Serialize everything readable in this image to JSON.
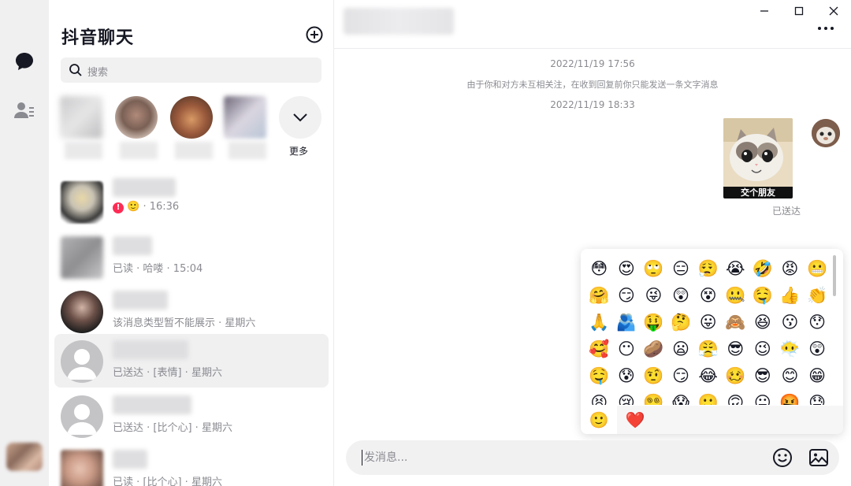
{
  "list": {
    "title": "抖音聊天",
    "search_placeholder": "搜索",
    "more_label": "更多",
    "conversations": [
      {
        "subtitle": "🙂 · 16:36",
        "alert": "!"
      },
      {
        "subtitle": "已读 · 哈喽 · 15:04"
      },
      {
        "subtitle": "该消息类型暂不能展示 · 星期六"
      },
      {
        "subtitle": "已送达 · [表情] · 星期六"
      },
      {
        "subtitle": "已送达 · [比个心] · 星期六"
      },
      {
        "subtitle": "已读 · [比个心] · 星期六"
      }
    ]
  },
  "chat": {
    "timestamp_1": "2022/11/19 17:56",
    "system_notice": "由于你和对方未互相关注，在收到回复前你只能发送一条文字消息",
    "timestamp_2": "2022/11/19 18:33",
    "sticker_caption": "交个朋友",
    "sent_status": "已送达",
    "input_placeholder": "发消息..."
  },
  "emoji_panel": {
    "emojis": [
      "😳",
      "😍",
      "🙄",
      "😑",
      "😮‍💨",
      "😭",
      "🤣",
      "😡",
      "😬",
      "🤗",
      "😏",
      "😜",
      "😲",
      "😵",
      "🤐",
      "🤤",
      "👍",
      "👏",
      "🙏",
      "🫂",
      "🤑",
      "🤔",
      "😛",
      "🙈",
      "😆",
      "😗",
      "😯",
      "🥰",
      "😶",
      "🥔",
      "😦",
      "😤",
      "😎",
      "😉",
      "😶‍🌫️",
      "😲",
      "🤤",
      "😰",
      "🤨",
      "😏",
      "😂",
      "🥴",
      "😎",
      "😊",
      "😁",
      "😫",
      "😢",
      "😵‍💫",
      "😱",
      "🙂",
      "🙃",
      "😐",
      "🤬",
      "😓"
    ],
    "tabs": [
      "🙂",
      "❤️"
    ]
  },
  "colors": {
    "accent": "#fe2c55",
    "text": "#161823",
    "muted": "#8a8b91",
    "rail": "#f0f0f1"
  }
}
